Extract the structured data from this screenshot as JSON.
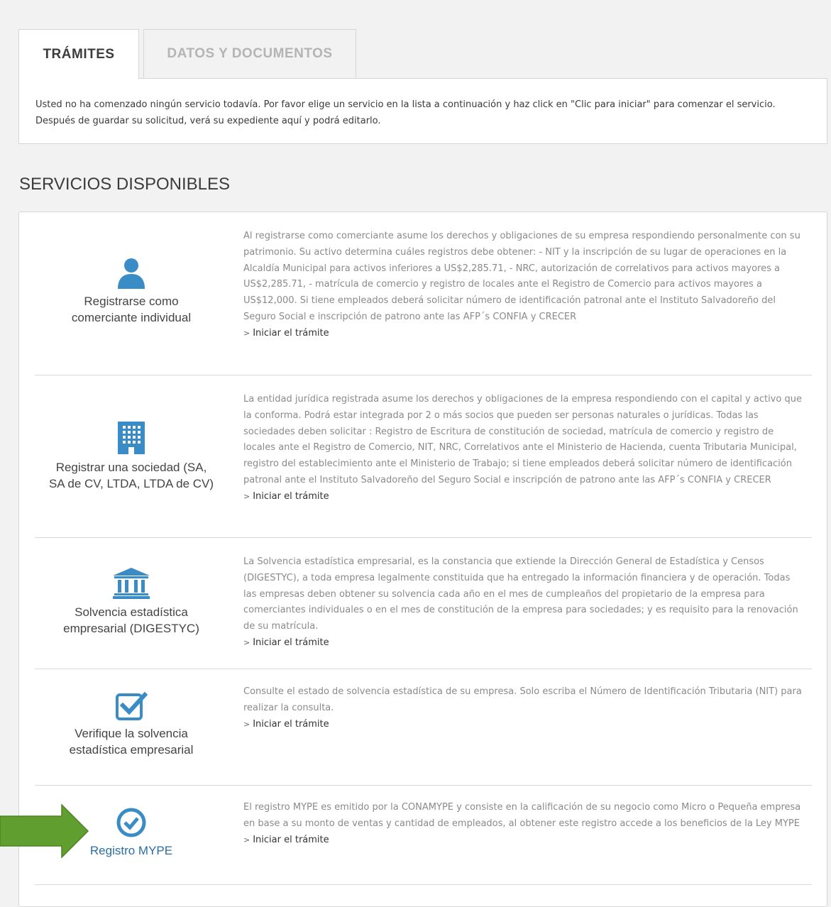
{
  "tabs": {
    "active_label": "TRÁMITES",
    "inactive_label": "DATOS Y DOCUMENTOS"
  },
  "notice": {
    "line1": "Usted no ha comenzado ningún servicio todavía. Por favor elige un servicio en la lista a continuación y haz click en \"Clic para iniciar\" para comenzar el servicio.",
    "line2": "Después de guardar su solicitud, verá su expediente aquí y podrá editarlo."
  },
  "section_title": "SERVICIOS DISPONIBLES",
  "start_label": "Iniciar el trámite",
  "colors": {
    "icon_blue": "#3a8cc6",
    "arrow_green": "#5f9e2f",
    "link_blue": "#2a6ea6"
  },
  "services": [
    {
      "icon": "person-icon",
      "name_line1": "Registrarse como",
      "name_line2": "comerciante individual",
      "desc": "Al registrarse como comerciante asume los derechos y obligaciones de su empresa respondiendo personalmente con su patrimonio. Su activo determina cuáles registros debe obtener: - NIT y la inscripción de su lugar de operaciones en la Alcaldía Municipal para activos inferiores a US$2,285.71, - NRC, autorización de correlativos para activos mayores a US$2,285.71, - matrícula de comercio y registro de locales ante el Registro de Comercio para activos mayores a US$12,000. Si tiene empleados deberá solicitar número de identificación patronal ante el Instituto Salvadoreño del Seguro Social e inscripción de patrono ante las AFP´s CONFIA y CRECER"
    },
    {
      "icon": "building-icon",
      "name_line1": "Registrar una sociedad (SA,",
      "name_line2": "SA de CV, LTDA, LTDA de CV)",
      "desc": "La entidad jurídica registrada asume los derechos y obligaciones de la empresa respondiendo con el capital y activo que la conforma. Podrá estar integrada por 2 o más socios que pueden ser personas naturales o jurídicas. Todas las sociedades deben solicitar : Registro de Escritura de constitución de sociedad, matrícula de comercio y registro de locales ante el Registro de Comercio, NIT, NRC, Correlativos ante el Ministerio de Hacienda, cuenta Tributaria Municipal, registro del establecimiento ante el Ministerio de Trabajo; si tiene empleados deberá solicitar número de identificación patronal ante el Instituto Salvadoreño del Seguro Social e inscripción de patrono ante las AFP´s CONFIA y CRECER"
    },
    {
      "icon": "institution-icon",
      "name_line1": "Solvencia estadística",
      "name_line2": "empresarial (DIGESTYC)",
      "desc": "La Solvencia estadística empresarial, es la constancia que extiende la Dirección General de Estadística y Censos (DIGESTYC), a toda empresa legalmente constituida que ha entregado la información financiera y de operación. Todas las empresas deben obtener su solvencia cada año en el mes de cumpleaños del propietario de la empresa para comerciantes individuales o en el mes de constitución de la empresa para sociedades; y es requisito para la renovación de su matrícula."
    },
    {
      "icon": "checkbox-icon",
      "name_line1": "Verifique la solvencia",
      "name_line2": "estadística empresarial",
      "desc": "Consulte el estado de solvencia estadística de su empresa. Solo escriba el Número de Identificación Tributaria (NIT) para realizar la consulta."
    },
    {
      "icon": "check-circle-icon",
      "name_line1": "Registro MYPE",
      "name_line2": "",
      "desc": "El registro MYPE es emitido por la CONAMYPE y consiste en la calificación de su negocio como Micro o Pequeña empresa en base a su monto de ventas y cantidad de empleados, al obtener este registro accede a los beneficios de la Ley MYPE"
    }
  ]
}
